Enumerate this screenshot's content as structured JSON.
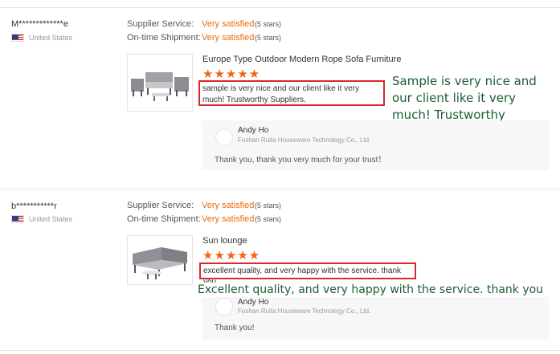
{
  "reviews": [
    {
      "username": "M*************e",
      "country": "United States",
      "ratings": [
        {
          "label": "Supplier Service:",
          "value": "Very satisfied",
          "stars": "(5 stars)"
        },
        {
          "label": "On-time Shipment:",
          "value": "Very satisfied",
          "stars": "(5 stars)"
        }
      ],
      "product_title": "Europe Type Outdoor Modern Rope Sofa Furniture",
      "star_glyphs": "★★★★★",
      "star_rating": 5,
      "review_text": "sample is very nice and our client like it very much! Trustworthy Suppliers.",
      "annotation": "Sample is very nice and our client like it very much! Trustworthy Suppliers.",
      "reply": {
        "name": "Andy Ho",
        "company": "Foshan Ruita Houseware Technology Co., Ltd.",
        "text": "Thank you, thank you very much for your trust！"
      }
    },
    {
      "username": "b***********r",
      "country": "United States",
      "ratings": [
        {
          "label": "Supplier Service:",
          "value": "Very satisfied",
          "stars": "(5 stars)"
        },
        {
          "label": "On-time Shipment:",
          "value": "Very satisfied",
          "stars": "(5 stars)"
        }
      ],
      "product_title": "Sun lounge",
      "star_glyphs": "★★★★★",
      "star_rating": 5,
      "review_text": "excellent quality, and very happy with the service. thank you",
      "annotation": "Excellent quality, and very happy with the service. thank you",
      "reply": {
        "name": "Andy Ho",
        "company": "Foshan Ruita Houseware Technology Co., Ltd.",
        "text": "Thank you!"
      }
    }
  ],
  "colors": {
    "accent_orange": "#ec6a0a",
    "star_orange": "#f2640a",
    "highlight_red": "#d9282e",
    "annotation_green": "#1c5c33"
  }
}
